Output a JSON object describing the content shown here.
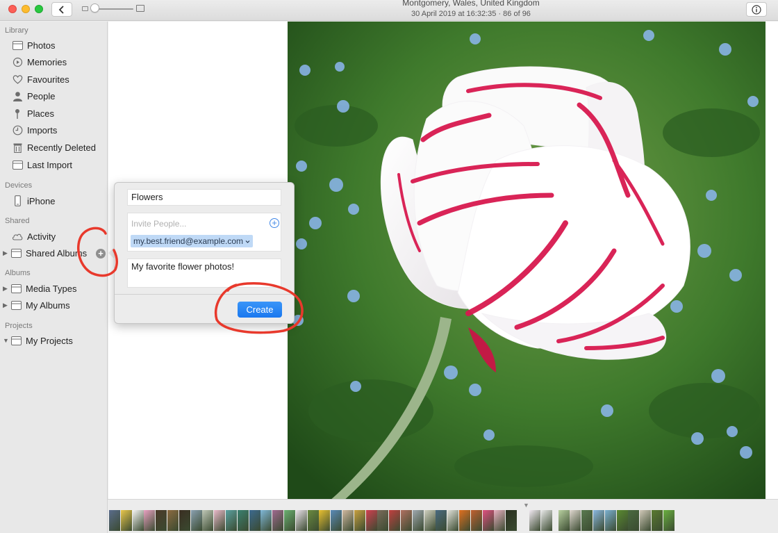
{
  "window": {
    "title_location": "Montgomery, Wales, United Kingdom",
    "title_datetime": "30 April 2019 at 16:32:35",
    "title_separator": "·",
    "title_position": "86 of 96",
    "icons": {
      "back": "chevron-left-icon",
      "info": "info-icon"
    }
  },
  "sidebar": {
    "sections": {
      "library": "Library",
      "devices": "Devices",
      "shared": "Shared",
      "albums": "Albums",
      "projects": "Projects"
    },
    "library_items": [
      {
        "label": "Photos",
        "icon": "photos-icon"
      },
      {
        "label": "Memories",
        "icon": "memories-icon"
      },
      {
        "label": "Favourites",
        "icon": "heart-icon"
      },
      {
        "label": "People",
        "icon": "person-icon"
      },
      {
        "label": "Places",
        "icon": "pin-icon"
      },
      {
        "label": "Imports",
        "icon": "clock-icon"
      },
      {
        "label": "Recently Deleted",
        "icon": "trash-icon"
      },
      {
        "label": "Last Import",
        "icon": "album-icon"
      }
    ],
    "devices_items": [
      {
        "label": "iPhone",
        "icon": "iphone-icon"
      }
    ],
    "shared_items": [
      {
        "label": "Activity",
        "icon": "cloud-icon"
      },
      {
        "label": "Shared Albums",
        "icon": "album-icon"
      }
    ],
    "albums_items": [
      {
        "label": "Media Types",
        "icon": "album-icon"
      },
      {
        "label": "My Albums",
        "icon": "album-icon"
      }
    ],
    "projects_items": [
      {
        "label": "My Projects",
        "icon": "album-icon"
      }
    ],
    "add_shared_album": "+"
  },
  "popover": {
    "album_name": "Flowers",
    "invite_placeholder": "Invite People...",
    "invitee": "my.best.friend@example.com",
    "comment": "My favorite flower photos!",
    "create_label": "Create"
  },
  "colors": {
    "accent_blue": "#1a78ef",
    "annotation_red": "#e8392c",
    "token_bg": "#bfd9f6"
  }
}
